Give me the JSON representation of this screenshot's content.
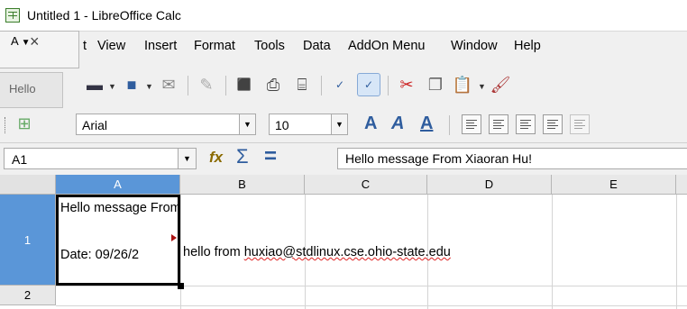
{
  "window": {
    "title": "Untitled 1 - LibreOffice Calc"
  },
  "menu": {
    "items": [
      {
        "label": "t",
        "ul": ""
      },
      {
        "label": "View",
        "ul": "V"
      },
      {
        "label": "Insert",
        "ul": "I"
      },
      {
        "label": "Format",
        "ul": "o"
      },
      {
        "label": "Tools",
        "ul": "T"
      },
      {
        "label": "Data",
        "ul": "D"
      },
      {
        "label": "AddOn Menu",
        "ul": "A"
      },
      {
        "label": "Window",
        "ul": "W"
      },
      {
        "label": "Help",
        "ul": "H"
      }
    ]
  },
  "overlay": {
    "top_label": "A",
    "close": "×",
    "hello": "Hello"
  },
  "format_toolbar": {
    "font_name": "Arial",
    "font_size": "10"
  },
  "formula_bar": {
    "cell_ref": "A1",
    "content": "Hello message From Xiaoran Hu!"
  },
  "grid": {
    "columns": [
      "A",
      "B",
      "C",
      "D",
      "E"
    ],
    "rows": [
      "1",
      "2"
    ],
    "a1_line1": "Hello message From Xiaoran Hu!",
    "a1_line2": "Date: 09/26/2",
    "b1_prefix": "hello from ",
    "b1_email": "huxiao@stdlinux.cse.ohio-state.edu"
  },
  "colors": {
    "selection": "#5a96d8",
    "accent": "#2f5d9e"
  }
}
